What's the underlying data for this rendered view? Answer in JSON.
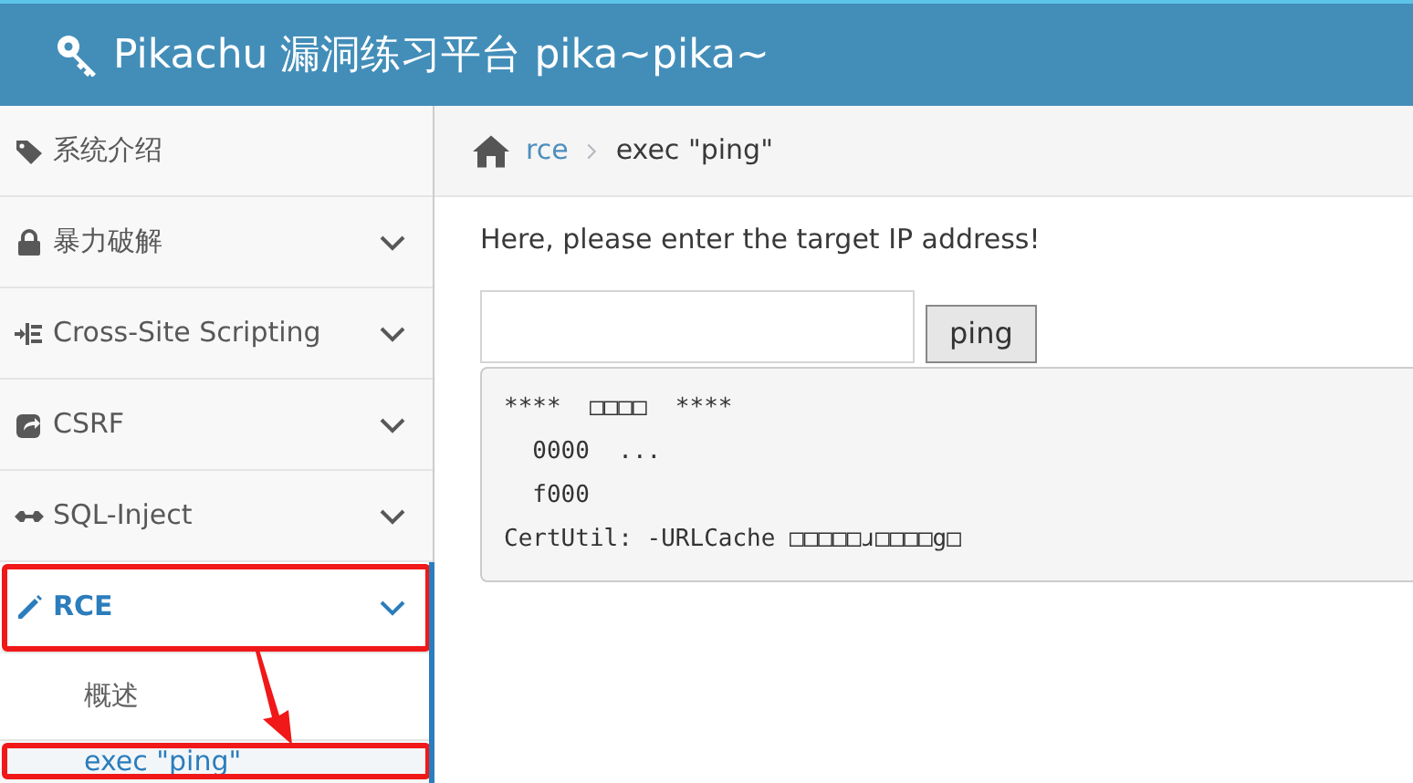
{
  "header": {
    "title": "Pikachu 漏洞练习平台 pika~pika~"
  },
  "sidebar": {
    "items": [
      {
        "label": "系统介绍",
        "kind": "link",
        "expanded": false,
        "highlighted": false
      },
      {
        "label": "暴力破解",
        "kind": "menu",
        "expanded": false,
        "highlighted": false
      },
      {
        "label": "Cross-Site Scripting",
        "kind": "menu",
        "expanded": false,
        "highlighted": false
      },
      {
        "label": "CSRF",
        "kind": "menu",
        "expanded": false,
        "highlighted": false
      },
      {
        "label": "SQL-Inject",
        "kind": "menu",
        "expanded": false,
        "highlighted": false
      },
      {
        "label": "RCE",
        "kind": "menu",
        "expanded": true,
        "highlighted": true,
        "children": [
          {
            "label": "概述",
            "selected": false,
            "highlighted": false
          },
          {
            "label": "exec \"ping\"",
            "selected": true,
            "highlighted": true
          }
        ]
      }
    ]
  },
  "annotation": {
    "arrow": true
  },
  "breadcrumb": [
    {
      "label": "rce",
      "link": true
    },
    {
      "label": "exec \"ping\"",
      "link": false
    }
  ],
  "form": {
    "prompt": "Here, please enter the target IP address!",
    "button": "ping"
  },
  "output": [
    "****  □□□□  ****",
    "  0000  ...",
    "  f000",
    "CertUtil: -URLCache □□□□□ɹ□□□□g□"
  ]
}
